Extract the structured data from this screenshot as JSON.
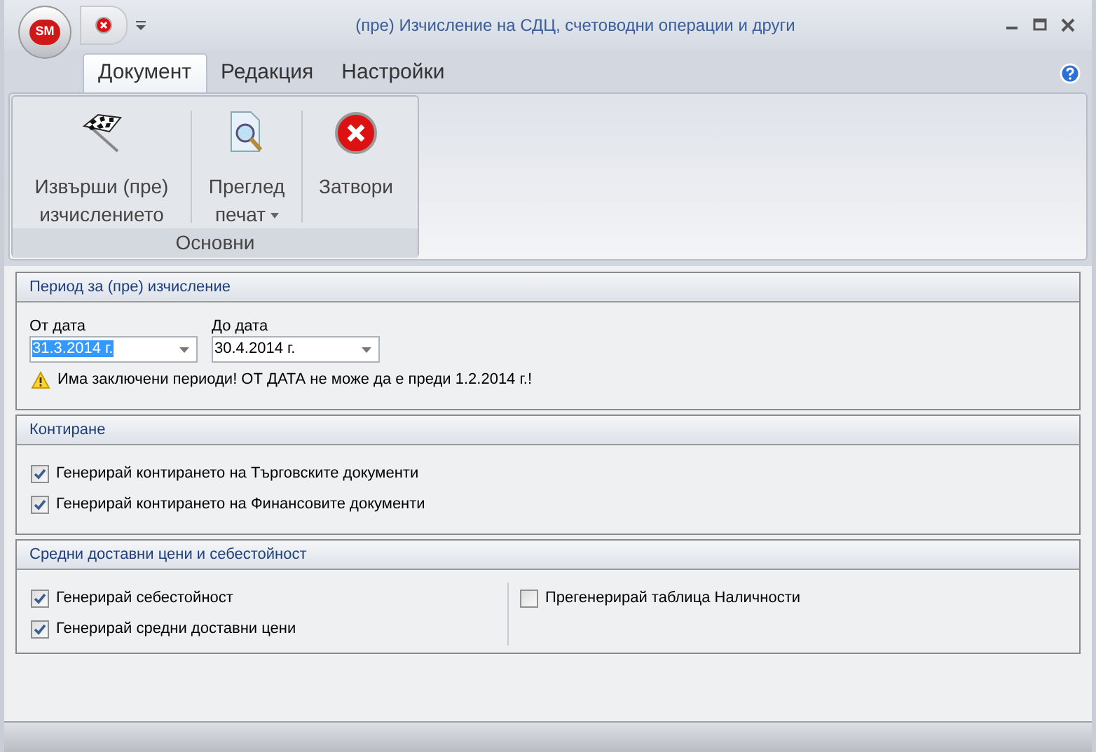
{
  "window": {
    "title": "(пре) Изчисление на СДЦ, счетоводни операции и други",
    "app_button": "SM"
  },
  "tabs": [
    {
      "label": "Документ",
      "selected": true
    },
    {
      "label": "Редакция",
      "selected": false
    },
    {
      "label": "Настройки",
      "selected": false
    }
  ],
  "ribbon": {
    "groups": [
      {
        "label": "Основни",
        "buttons": [
          {
            "kind": "flag",
            "label": "Извърши (пре) изчислението",
            "has_menu": false
          },
          {
            "kind": "preview",
            "label": "Преглед печат",
            "has_menu": true
          },
          {
            "kind": "close",
            "label": "Затвори",
            "has_menu": false
          }
        ]
      }
    ]
  },
  "period": {
    "title": "Период за (пре) изчисление",
    "fields": [
      {
        "label": "От дата",
        "value": "31.3.2014 г.",
        "selected": true
      },
      {
        "label": "До дата",
        "value": "30.4.2014 г.",
        "selected": false
      }
    ],
    "warning": "Има заключени периоди! ОТ ДАТА не може да е преди 1.2.2014 г.!"
  },
  "posting": {
    "title": "Контиране",
    "options": [
      {
        "label": "Генерирай контирането на Търговските документи",
        "checked": true
      },
      {
        "label": "Генерирай контирането на Финансовите документи",
        "checked": true
      }
    ]
  },
  "costs": {
    "title": "Средни доставни цени и себестойност",
    "columns": [
      [
        {
          "label": "Генерирай себестойност",
          "checked": true
        },
        {
          "label": "Генерирай средни доставни цени",
          "checked": true
        }
      ],
      [
        {
          "label": "Прегенерирай таблица Наличности",
          "checked": false
        }
      ]
    ]
  }
}
